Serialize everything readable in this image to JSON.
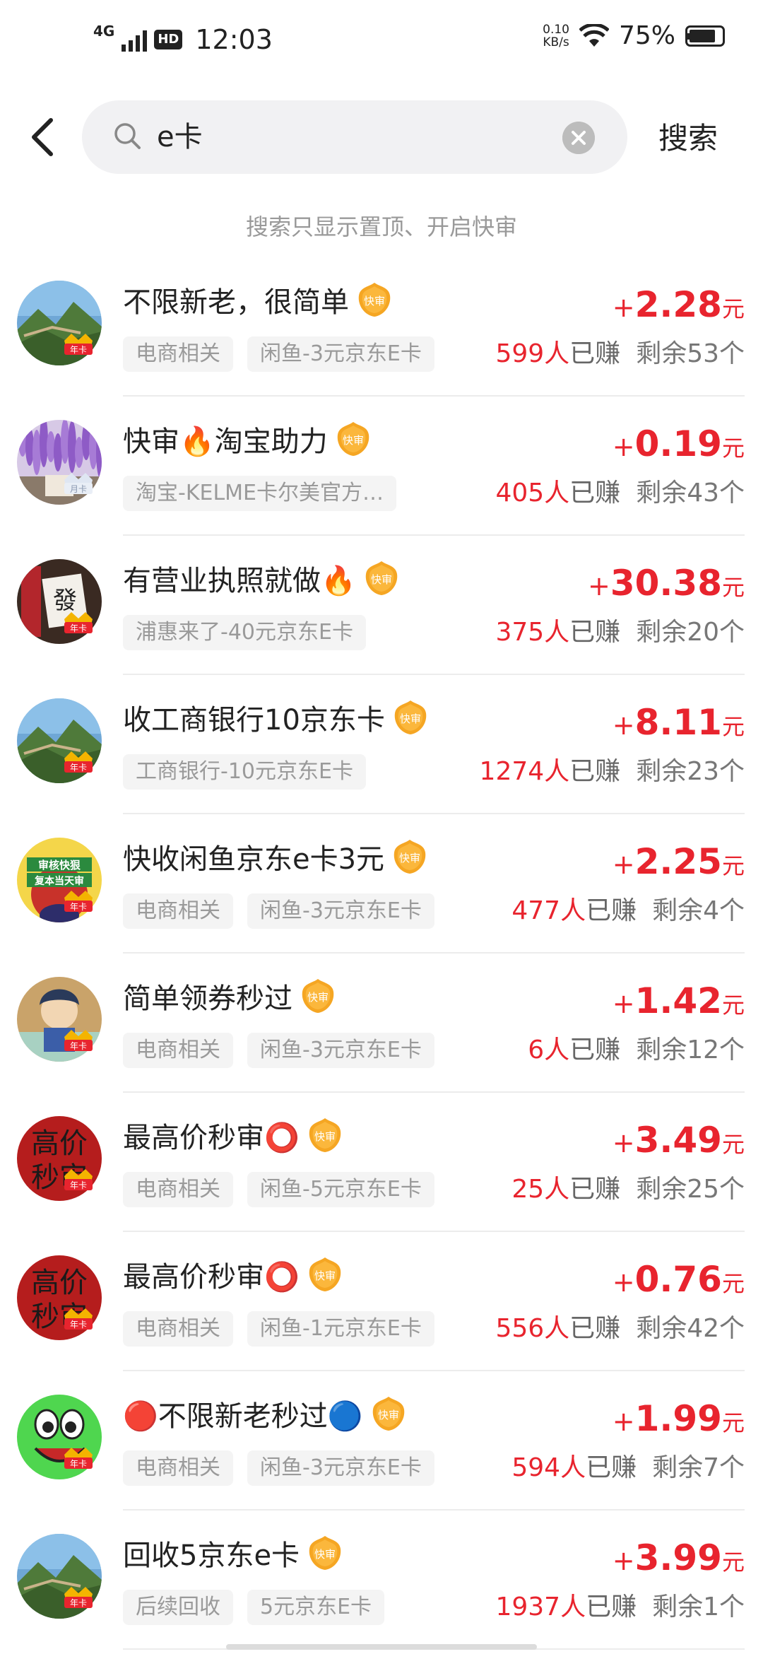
{
  "status": {
    "network": "4G",
    "hd": "HD",
    "time": "12:03",
    "speed_value": "0.10",
    "speed_unit": "KB/s",
    "battery": "75%"
  },
  "search": {
    "query": "e卡",
    "button": "搜索",
    "tip": "搜索只显示置顶、开启快审"
  },
  "colors": {
    "price": "#e8242e",
    "fast_badge": "#f5a623"
  },
  "items": [
    {
      "title": "不限新老，很简单",
      "emoji": "",
      "emoji2": "",
      "badge": "年卡",
      "tags": [
        "电商相关",
        "闲鱼-3元京东E卡"
      ],
      "plus": "+",
      "price": "2.28",
      "unit": "元",
      "count": "599人",
      "earned": "已赚",
      "remaining": "剩余53个"
    },
    {
      "title": "快审🔥淘宝助力",
      "emoji": "",
      "emoji2": "",
      "badge": "月卡",
      "tags": [
        "淘宝-KELME卡尔美官方…"
      ],
      "plus": "+",
      "price": "0.19",
      "unit": "元",
      "count": "405人",
      "earned": "已赚",
      "remaining": "剩余43个"
    },
    {
      "title": "有营业执照就做🔥",
      "emoji": "",
      "emoji2": "",
      "badge": "年卡",
      "tags": [
        "浦惠来了-40元京东E卡"
      ],
      "plus": "+",
      "price": "30.38",
      "unit": "元",
      "count": "375人",
      "earned": "已赚",
      "remaining": "剩余20个"
    },
    {
      "title": "收工商银行10京东卡",
      "emoji": "",
      "emoji2": "",
      "badge": "年卡",
      "tags": [
        "工商银行-10元京东E卡"
      ],
      "plus": "+",
      "price": "8.11",
      "unit": "元",
      "count": "1274人",
      "earned": "已赚",
      "remaining": "剩余23个"
    },
    {
      "title": "快收闲鱼京东e卡3元",
      "emoji": "",
      "emoji2": "",
      "badge": "年卡",
      "tags": [
        "电商相关",
        "闲鱼-3元京东E卡"
      ],
      "plus": "+",
      "price": "2.25",
      "unit": "元",
      "count": "477人",
      "earned": "已赚",
      "remaining": "剩余4个"
    },
    {
      "title": "简单领券秒过",
      "emoji": "",
      "emoji2": "",
      "badge": "年卡",
      "tags": [
        "电商相关",
        "闲鱼-3元京东E卡"
      ],
      "plus": "+",
      "price": "1.42",
      "unit": "元",
      "count": "6人",
      "earned": "已赚",
      "remaining": "剩余12个"
    },
    {
      "title": "最高价秒审⭕",
      "emoji": "",
      "emoji2": "",
      "badge": "年卡",
      "tags": [
        "电商相关",
        "闲鱼-5元京东E卡"
      ],
      "plus": "+",
      "price": "3.49",
      "unit": "元",
      "count": "25人",
      "earned": "已赚",
      "remaining": "剩余25个"
    },
    {
      "title": "最高价秒审⭕",
      "emoji": "",
      "emoji2": "",
      "badge": "年卡",
      "tags": [
        "电商相关",
        "闲鱼-1元京东E卡"
      ],
      "plus": "+",
      "price": "0.76",
      "unit": "元",
      "count": "556人",
      "earned": "已赚",
      "remaining": "剩余42个"
    },
    {
      "title": "🔴不限新老秒过🔵",
      "emoji": "",
      "emoji2": "",
      "badge": "年卡",
      "tags": [
        "电商相关",
        "闲鱼-3元京东E卡"
      ],
      "plus": "+",
      "price": "1.99",
      "unit": "元",
      "count": "594人",
      "earned": "已赚",
      "remaining": "剩余7个"
    },
    {
      "title": "回收5京东e卡",
      "emoji": "",
      "emoji2": "",
      "badge": "年卡",
      "tags": [
        "后续回收",
        "5元京东E卡"
      ],
      "plus": "+",
      "price": "3.99",
      "unit": "元",
      "count": "1937人",
      "earned": "已赚",
      "remaining": "剩余1个"
    }
  ],
  "avatar_style": [
    "mountain",
    "wisteria",
    "door",
    "mountain",
    "cartoon",
    "anime",
    "red-text",
    "red-text",
    "frog",
    "mountain"
  ],
  "avatar_text": {
    "red": "高价秒审",
    "cartoon_top": "审核快狠",
    "cartoon_bottom": "复本当天审"
  },
  "fast_badge_label": "快审"
}
